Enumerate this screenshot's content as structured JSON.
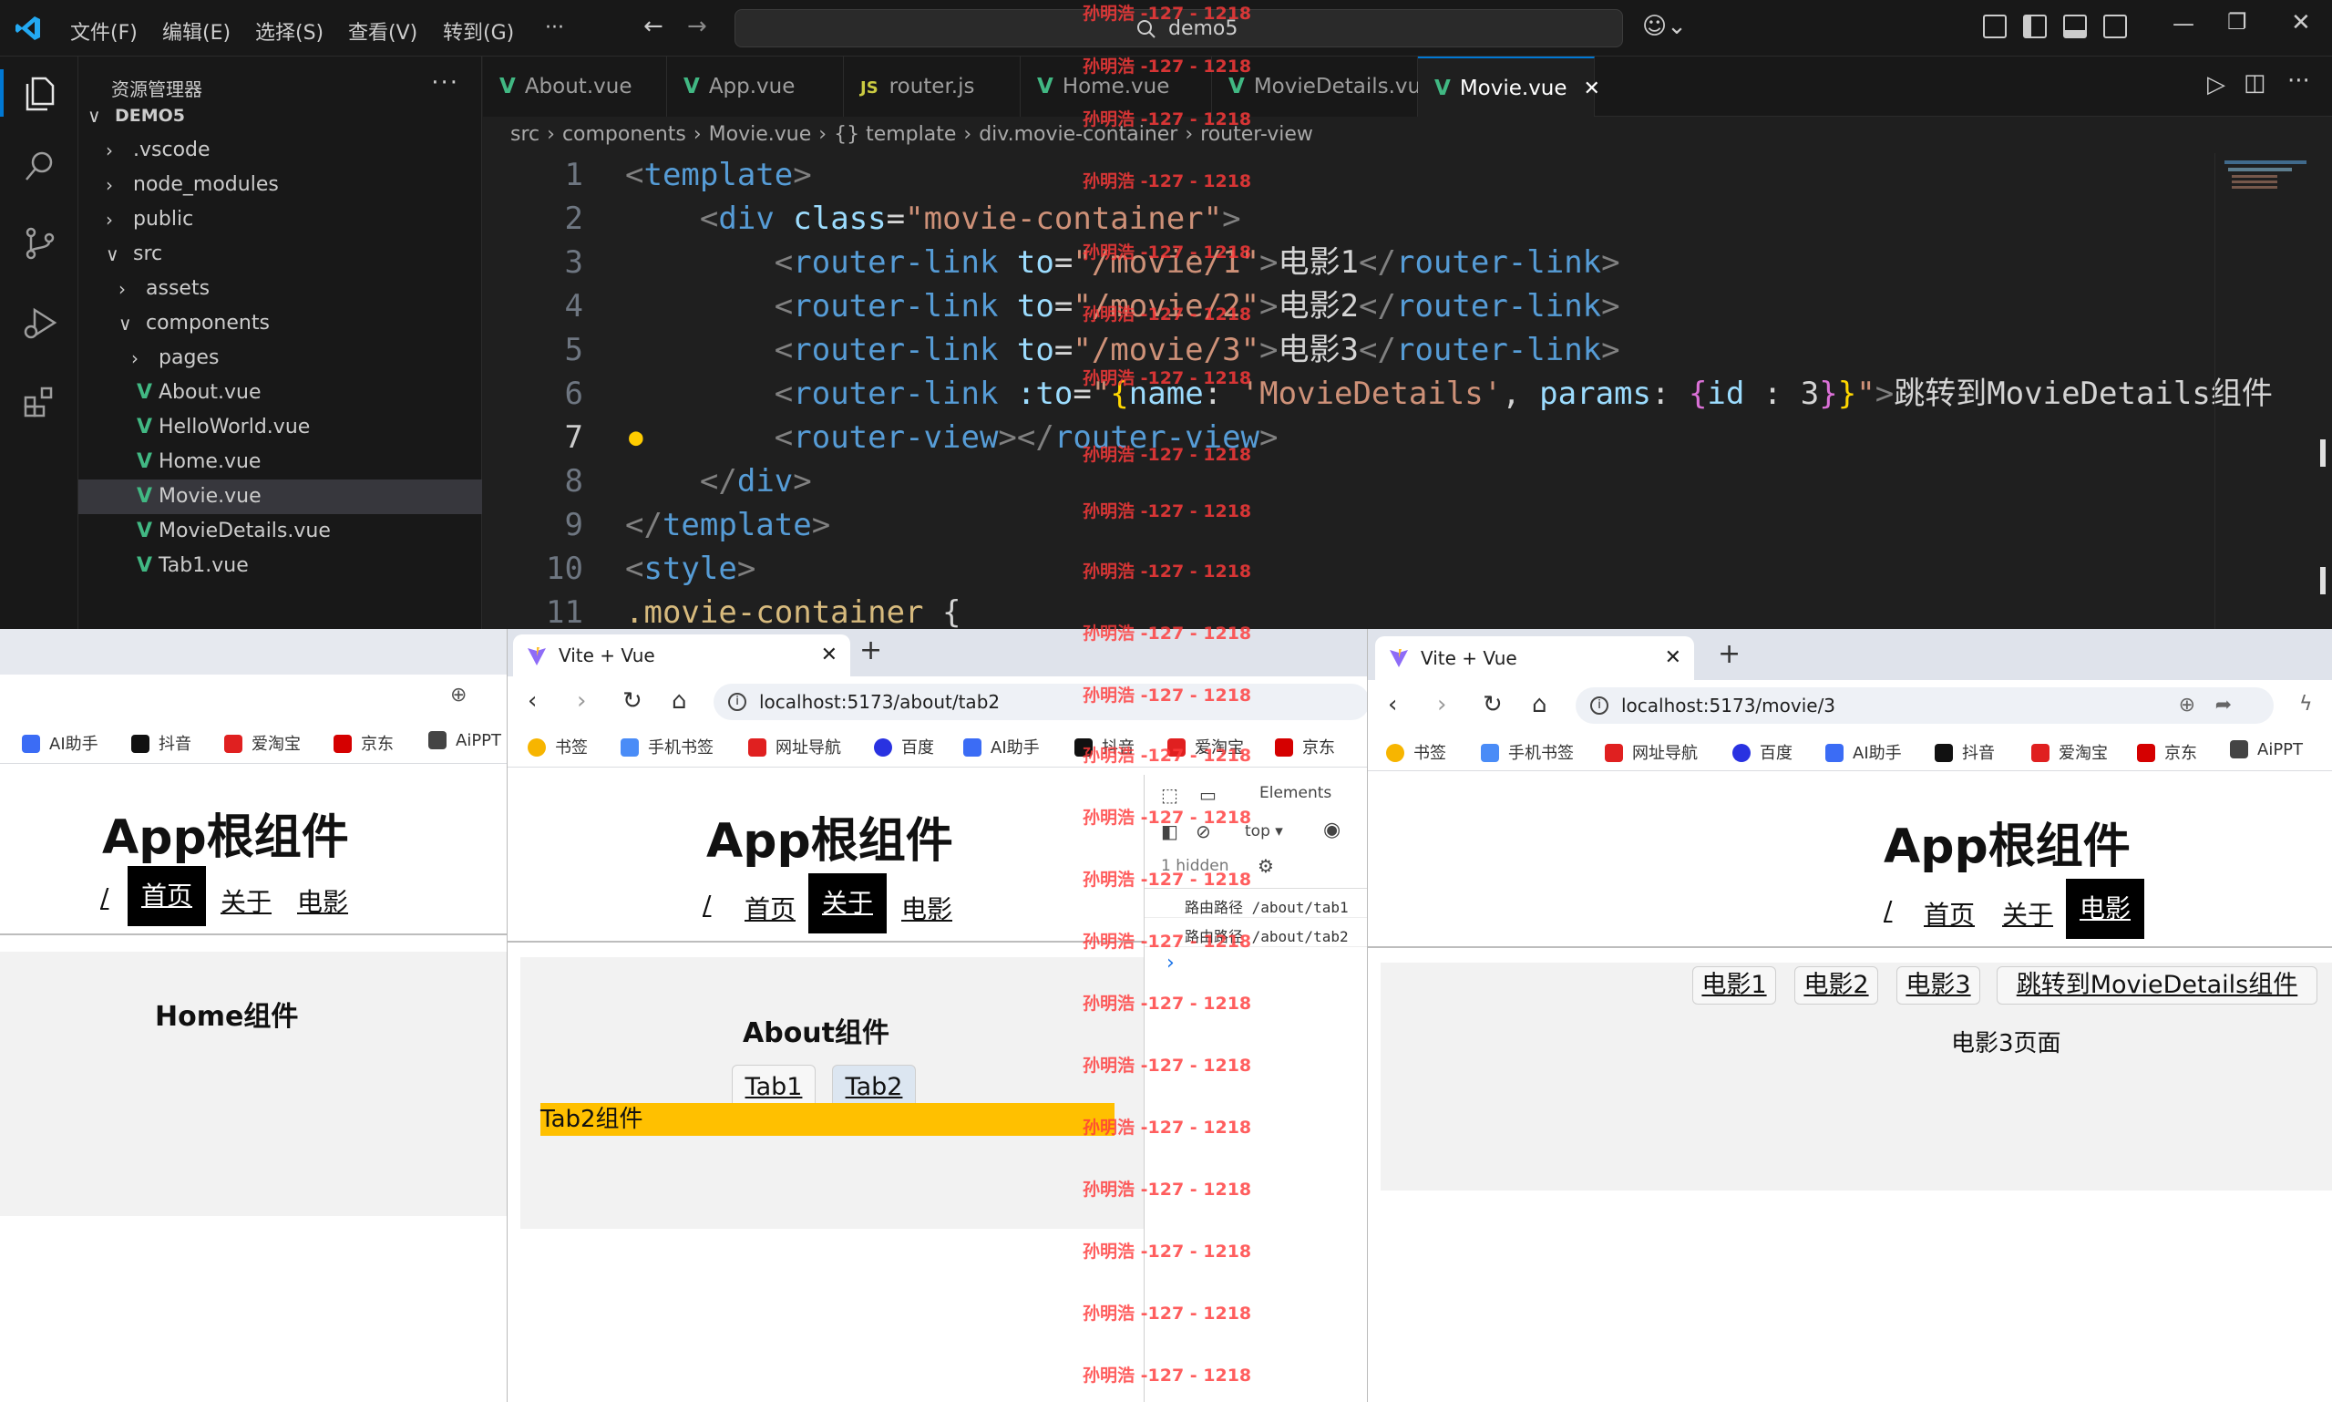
{
  "vscode": {
    "menu": [
      "文件(F)",
      "编辑(E)",
      "选择(S)",
      "查看(V)",
      "转到(G)",
      "···"
    ],
    "search_text": "demo5",
    "explorer_title": "资源管理器",
    "explorer_more": "···",
    "tree": [
      {
        "label": "DEMO5",
        "chev": "∨"
      },
      {
        "label": ".vscode",
        "chev": "›"
      },
      {
        "label": "node_modules",
        "chev": "›"
      },
      {
        "label": "public",
        "chev": "›"
      },
      {
        "label": "src",
        "chev": "∨"
      },
      {
        "label": "assets",
        "chev": "›"
      },
      {
        "label": "components",
        "chev": "∨"
      },
      {
        "label": "pages",
        "chev": "›"
      },
      {
        "label": "About.vue",
        "icon": "V"
      },
      {
        "label": "HelloWorld.vue",
        "icon": "V"
      },
      {
        "label": "Home.vue",
        "icon": "V"
      },
      {
        "label": "Movie.vue",
        "icon": "V"
      },
      {
        "label": "MovieDetails.vue",
        "icon": "V"
      },
      {
        "label": "Tab1.vue",
        "icon": "V"
      }
    ],
    "tabs": [
      {
        "label": "About.vue",
        "icon": "V"
      },
      {
        "label": "App.vue",
        "icon": "V"
      },
      {
        "label": "router.js",
        "icon": "JS"
      },
      {
        "label": "Home.vue",
        "icon": "V"
      },
      {
        "label": "MovieDetails.vue",
        "icon": "V"
      },
      {
        "label": "Movie.vue",
        "icon": "V",
        "close": "✕"
      }
    ],
    "breadcrumb": [
      "src",
      "›",
      "components",
      "›",
      "Movie.vue",
      "›",
      "{} template",
      "›",
      "div.movie-container",
      "›",
      "router-view"
    ],
    "line_numbers": [
      "1",
      "2",
      "3",
      "4",
      "5",
      "6",
      "7",
      "8",
      "9",
      "10",
      "11"
    ],
    "accent": "#0078d4",
    "vue_color": "#41b883"
  },
  "watermark": "孙明浩 -127 - 1218",
  "browsers": {
    "tab_title": "Vite + Vue",
    "tab_close": "✕",
    "new_tab": "+",
    "url_middle": "localhost:5173/about/tab2",
    "url_right": "localhost:5173/movie/3",
    "bookmarks_left": [
      "AI助手",
      "抖音",
      "爱淘宝",
      "京东",
      "AiPPT"
    ],
    "bookmarks_middle": [
      "书签",
      "手机书签",
      "网址导航",
      "百度",
      "AI助手",
      "抖音",
      "爱淘宝",
      "京东"
    ],
    "bookmarks_right": [
      "书签",
      "手机书签",
      "网址导航",
      "百度",
      "AI助手",
      "抖音",
      "爱淘宝",
      "京东",
      "AiPPT"
    ],
    "app_title": "App根组件",
    "nav": [
      "/",
      "首页",
      "关于",
      "电影"
    ],
    "home_component": "Home组件",
    "about_component": "About组件",
    "about_tabs": [
      "Tab1",
      "Tab2"
    ],
    "tab2_component": "Tab2组件",
    "movie_links": [
      "电影1",
      "电影2",
      "电影3",
      "跳转到MovieDetails组件"
    ],
    "movie_page": "电影3页面",
    "tab2_bar_color": "#ffc000"
  },
  "devtools": {
    "elements_tab": "Elements",
    "context": "top ▾",
    "hidden": "1 hidden",
    "log1": "路由路径 /about/tab1",
    "log2": "路由路径 /about/tab2",
    "prompt": "›"
  }
}
